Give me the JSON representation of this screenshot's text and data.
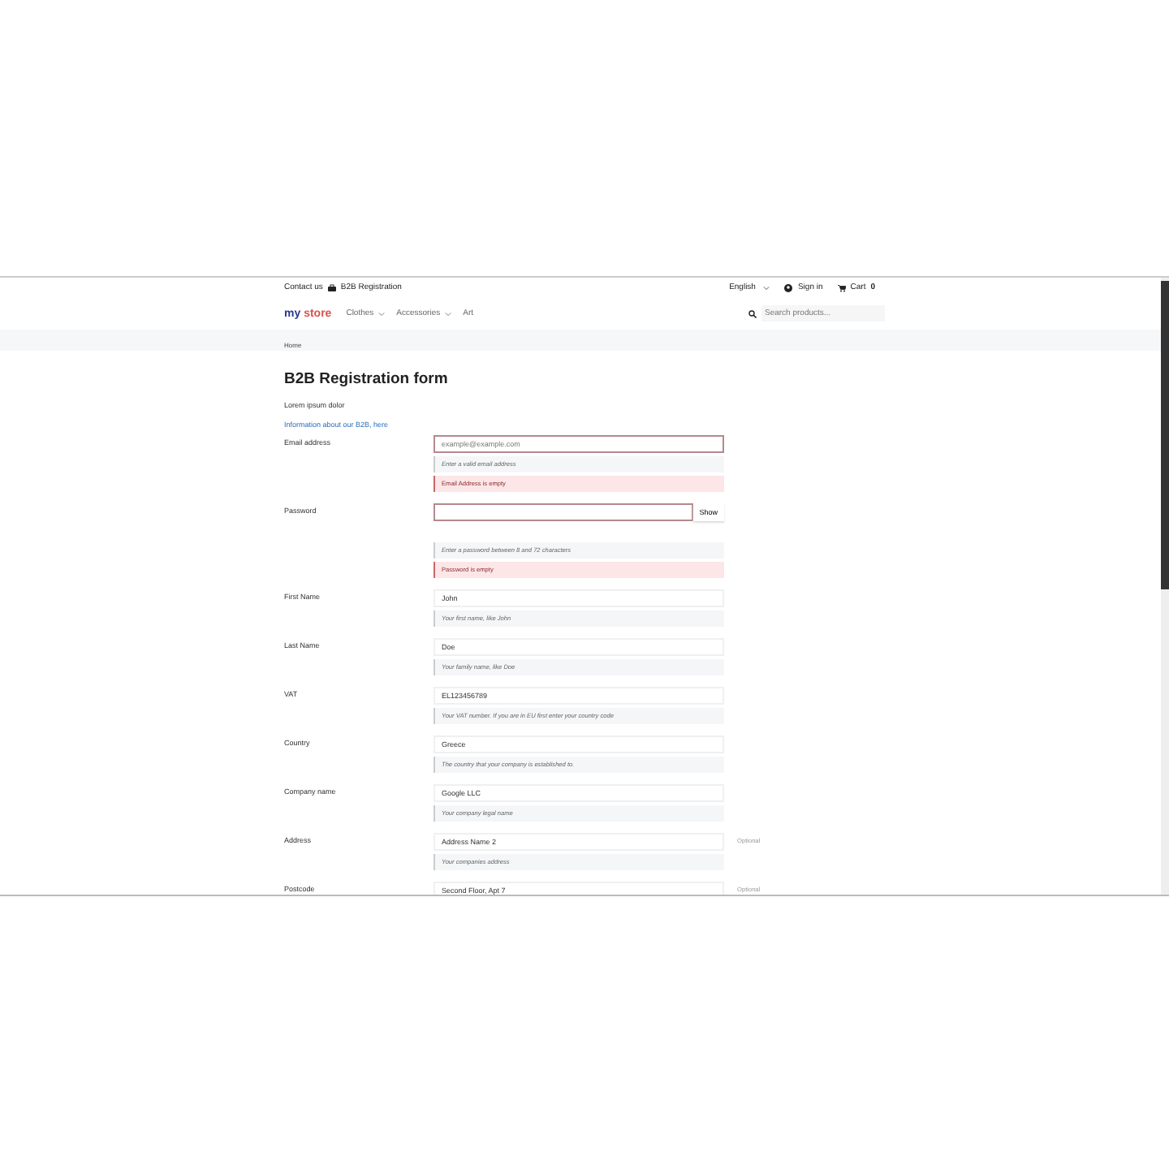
{
  "topbar": {
    "contact": "Contact us",
    "b2b_link": "B2B Registration",
    "language": "English",
    "sign_in": "Sign in",
    "cart": "Cart",
    "cart_count": "0"
  },
  "nav": {
    "logo_a": "my",
    "logo_b": "store",
    "menu": [
      {
        "label": "Clothes",
        "dropdown": true
      },
      {
        "label": "Accessories",
        "dropdown": true
      },
      {
        "label": "Art",
        "dropdown": false
      }
    ],
    "search": {
      "placeholder": "Search products..."
    }
  },
  "breadcrumb": "Home",
  "title": "B2B Registration form",
  "intro": "Lorem ipsum dolor",
  "info_link": "Information about our B2B, here",
  "fields": [
    {
      "label": "Email address",
      "kind": "email",
      "placeholder": "example@example.com",
      "hint": "Enter a valid email address",
      "error": "Email Address is empty",
      "invalid": true
    },
    {
      "label": "Password",
      "kind": "password",
      "button": "Show",
      "hint": "Enter a password between 8 and 72 characters",
      "error": "Password is empty",
      "invalid": true
    },
    {
      "label": "First Name",
      "kind": "text",
      "value": "John",
      "hint": "Your first name, like John",
      "invalid": false
    },
    {
      "label": "Last Name",
      "kind": "text",
      "value": "Doe",
      "hint": "Your family name, like Doe",
      "invalid": false
    },
    {
      "label": "VAT",
      "kind": "text",
      "value": "EL123456789",
      "hint": "Your VAT number. If you are in EU first enter your country code",
      "invalid": false
    },
    {
      "label": "Country",
      "kind": "text",
      "value": "Greece",
      "hint": "The country that your company is established to.",
      "invalid": false
    },
    {
      "label": "Company name",
      "kind": "text",
      "value": "Google LLC",
      "hint": "Your company legal name",
      "invalid": false
    },
    {
      "label": "Address",
      "kind": "text",
      "value": "Address Name 2",
      "hint": "Your companies address",
      "optional": "Optional",
      "invalid": false
    },
    {
      "label": "Postcode",
      "kind": "text",
      "value": "Second Floor, Apt 7",
      "optional": "Optional",
      "invalid": false
    }
  ]
}
